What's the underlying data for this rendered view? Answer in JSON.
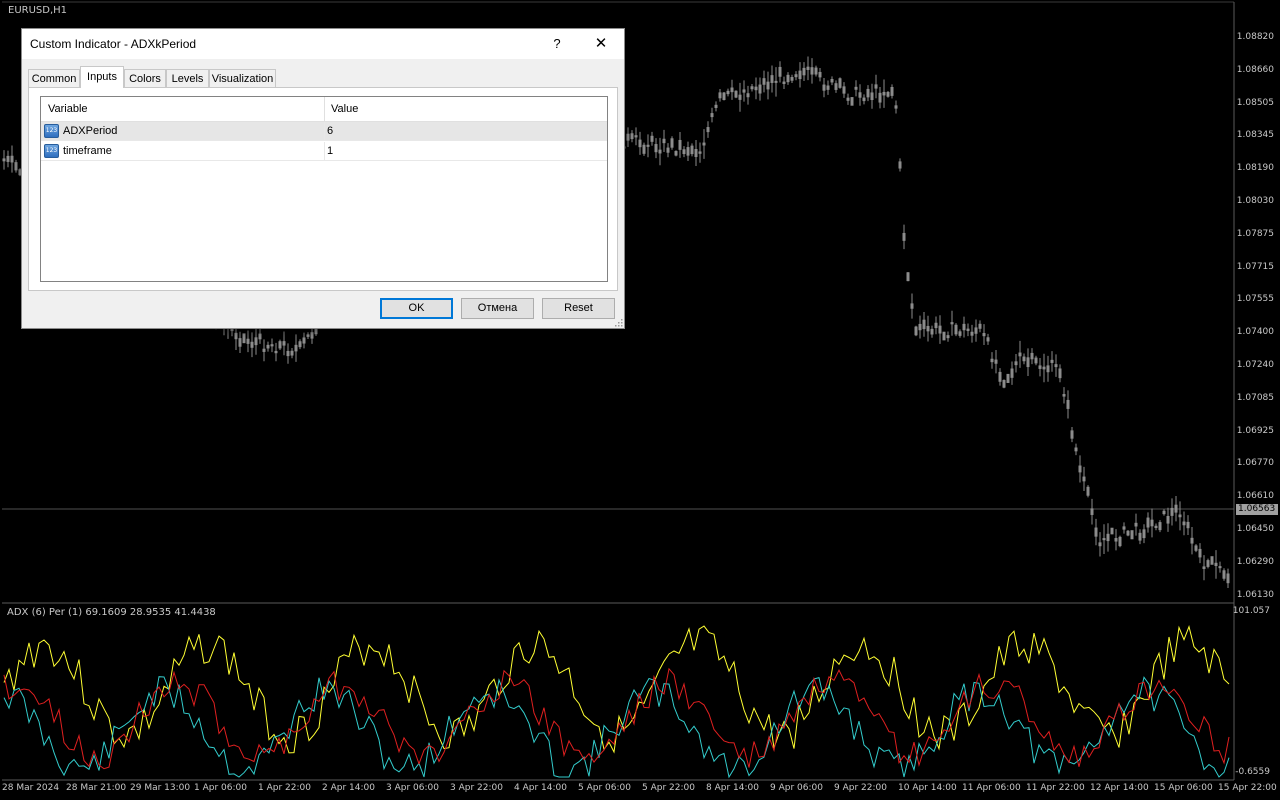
{
  "chart": {
    "symbol_label": "EURUSD,H1",
    "current_price": "1.06563",
    "price_ticks": [
      "1.08820",
      "1.08660",
      "1.08505",
      "1.08345",
      "1.08190",
      "1.08030",
      "1.07875",
      "1.07715",
      "1.07555",
      "1.07400",
      "1.07240",
      "1.07085",
      "1.06925",
      "1.06770",
      "1.06610",
      "1.06450",
      "1.06290",
      "1.06130"
    ],
    "time_ticks": [
      "28 Mar 2024",
      "28 Mar 21:00",
      "29 Mar 13:00",
      "1 Apr 06:00",
      "1 Apr 22:00",
      "2 Apr 14:00",
      "3 Apr 06:00",
      "3 Apr 22:00",
      "4 Apr 14:00",
      "5 Apr 06:00",
      "5 Apr 22:00",
      "8 Apr 14:00",
      "9 Apr 06:00",
      "9 Apr 22:00",
      "10 Apr 14:00",
      "11 Apr 06:00",
      "11 Apr 22:00",
      "12 Apr 14:00",
      "15 Apr 06:00",
      "15 Apr 22:00"
    ],
    "colors": {
      "background": "#000000",
      "candles": "#8c8c8c",
      "adx": "#ffff33",
      "plus_di": "#33cccc",
      "minus_di": "#e02020"
    }
  },
  "adx_panel": {
    "label": "ADX (6)  Per (1)    69.1609  28.9535  41.4438",
    "max_label": "101.057",
    "min_label": "-0.6559"
  },
  "dialog": {
    "title": "Custom Indicator - ADXkPeriod",
    "help_label": "?",
    "close_label": "✕",
    "tabs": [
      {
        "label": "Common"
      },
      {
        "label": "Inputs"
      },
      {
        "label": "Colors"
      },
      {
        "label": "Levels"
      },
      {
        "label": "Visualization"
      }
    ],
    "grid": {
      "col_variable": "Variable",
      "col_value": "Value",
      "rows": [
        {
          "icon": "123",
          "name": "ADXPeriod",
          "value": "6"
        },
        {
          "icon": "123",
          "name": "timeframe",
          "value": "1"
        }
      ]
    },
    "buttons": {
      "ok": "OK",
      "cancel": "Отмена",
      "reset": "Reset"
    }
  }
}
